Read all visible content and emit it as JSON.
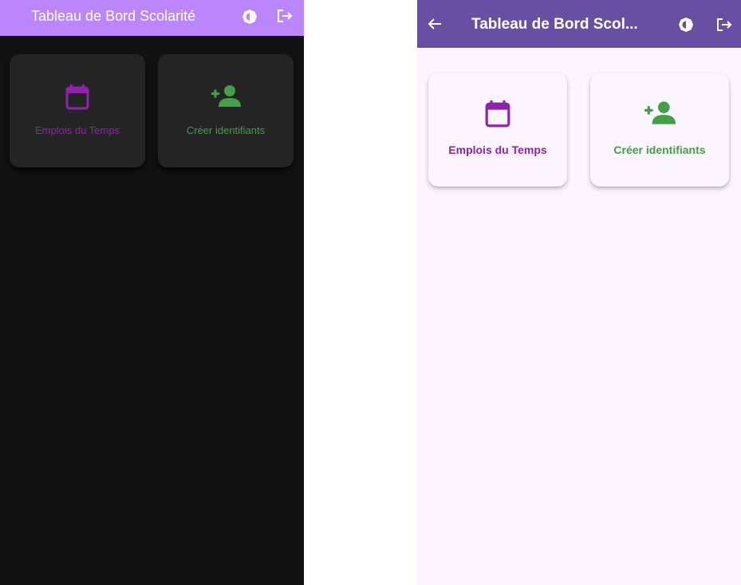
{
  "dark_screen": {
    "theme": "dark",
    "appbar": {
      "title": "Tableau de Bord Scolarité",
      "color": "#bb86fc",
      "actions": [
        {
          "icon": "brightness-icon"
        },
        {
          "icon": "logout-icon"
        }
      ]
    },
    "background": "#121212",
    "cards": [
      {
        "label": "Emplois du Temps",
        "icon": "calendar-icon",
        "color": "#8e24aa"
      },
      {
        "label": "Créer identifiants",
        "icon": "person-add-icon",
        "color": "#43a047"
      }
    ]
  },
  "light_screen": {
    "theme": "light",
    "appbar": {
      "title": "Tableau de Bord Scol...",
      "color": "#6750a4",
      "leading": {
        "icon": "back-arrow-icon"
      },
      "actions": [
        {
          "icon": "brightness-icon"
        },
        {
          "icon": "logout-icon"
        }
      ]
    },
    "background": "#fcf5ff",
    "cards": [
      {
        "label": "Emplois du Temps",
        "icon": "calendar-icon",
        "color": "#8e24aa"
      },
      {
        "label": "Créer identifiants",
        "icon": "person-add-icon",
        "color": "#43a047"
      }
    ]
  }
}
